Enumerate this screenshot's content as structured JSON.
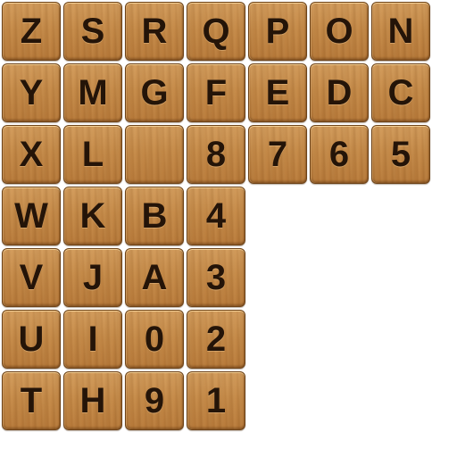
{
  "board": {
    "tiles": [
      [
        "Z",
        "S",
        "R",
        "Q",
        "P",
        "O",
        "N"
      ],
      [
        "Y",
        "M",
        "G",
        "F",
        "E",
        "D",
        "C"
      ],
      [
        "X",
        "L",
        "",
        "8",
        "7",
        "6",
        "5"
      ],
      [
        "W",
        "K",
        "B",
        "4"
      ],
      [
        "V",
        "J",
        "A",
        "3"
      ],
      [
        "U",
        "I",
        "0",
        "2"
      ],
      [
        "T",
        "H",
        "9",
        "1"
      ]
    ]
  }
}
